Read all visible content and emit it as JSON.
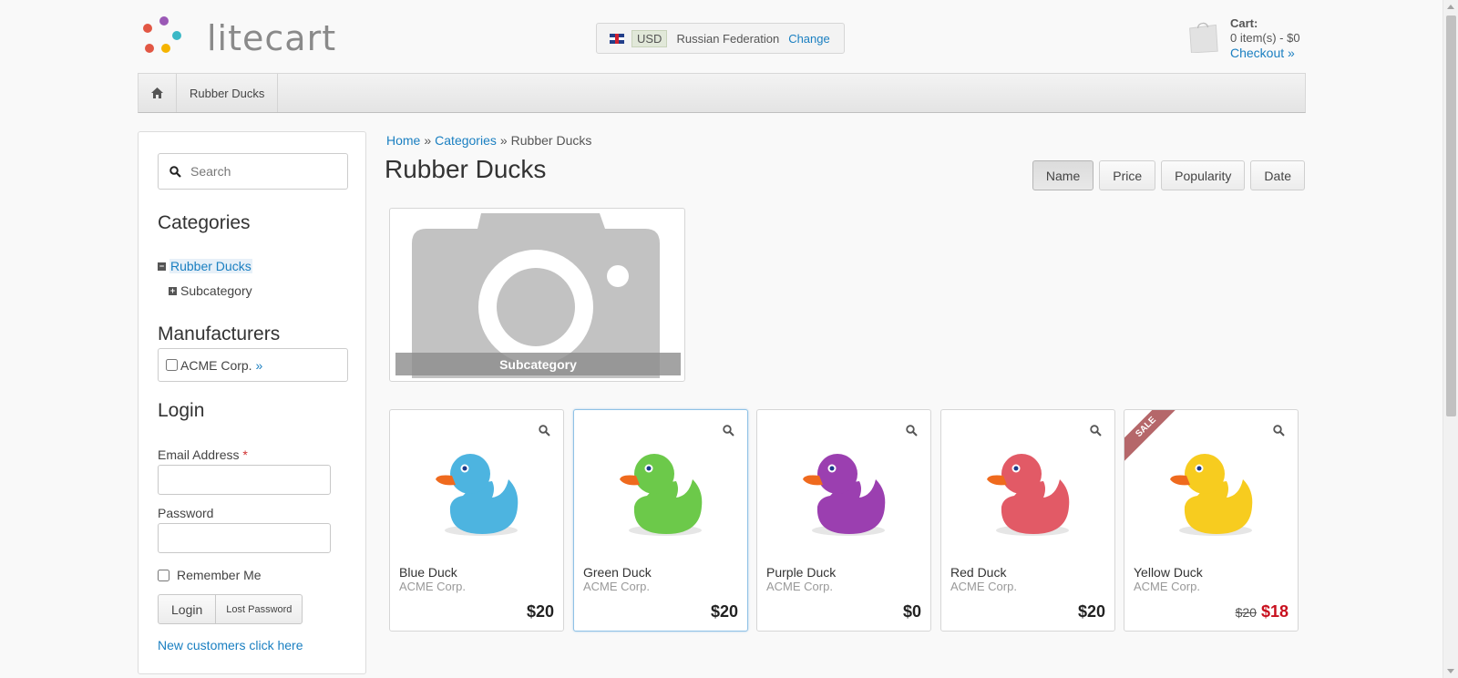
{
  "brand": {
    "logo_text": "litecart",
    "dot_colors": [
      "#e25744",
      "#9b59b6",
      "#3bb8c6",
      "#f5b400",
      "#e25744"
    ]
  },
  "region": {
    "currency": "USD",
    "country": "Russian Federation",
    "change_label": "Change"
  },
  "cart": {
    "title": "Cart:",
    "summary": "0 item(s) - $0",
    "checkout_label": "Checkout »"
  },
  "nav": {
    "home_icon": "home-icon",
    "items": [
      "Rubber Ducks"
    ]
  },
  "sidebar": {
    "search_placeholder": "Search",
    "categories_heading": "Categories",
    "categories": [
      {
        "label": "Rubber Ducks",
        "state": "expanded",
        "active": true
      },
      {
        "label": "Subcategory",
        "state": "collapsed",
        "active": false
      }
    ],
    "manufacturers_heading": "Manufacturers",
    "manufacturer": {
      "label": "ACME Corp.",
      "link": "»"
    },
    "login_heading": "Login",
    "email_label": "Email Address",
    "email_required": "*",
    "password_label": "Password",
    "remember_label": "Remember Me",
    "login_button": "Login",
    "lost_password_button": "Lost Password",
    "new_customers_link": "New customers click here"
  },
  "breadcrumb": {
    "home": "Home",
    "categories": "Categories",
    "current": "Rubber Ducks",
    "separator": "»"
  },
  "page_title": "Rubber Ducks",
  "sort": {
    "options": [
      "Name",
      "Price",
      "Popularity",
      "Date"
    ],
    "active": "Name"
  },
  "subcategory_card": {
    "caption": "Subcategory"
  },
  "products": [
    {
      "name": "Blue Duck",
      "manufacturer": "ACME Corp.",
      "price": "$20",
      "color": "#4db4e0",
      "sale": false
    },
    {
      "name": "Green Duck",
      "manufacturer": "ACME Corp.",
      "price": "$20",
      "color": "#6cc94a",
      "sale": false
    },
    {
      "name": "Purple Duck",
      "manufacturer": "ACME Corp.",
      "price": "$0",
      "color": "#9b3fb0",
      "sale": false
    },
    {
      "name": "Red Duck",
      "manufacturer": "ACME Corp.",
      "price": "$20",
      "color": "#e25a66",
      "sale": false
    },
    {
      "name": "Yellow Duck",
      "manufacturer": "ACME Corp.",
      "old_price": "$20",
      "price": "$18",
      "color": "#f7cc1f",
      "sale": true,
      "sale_label": "SALE"
    }
  ]
}
